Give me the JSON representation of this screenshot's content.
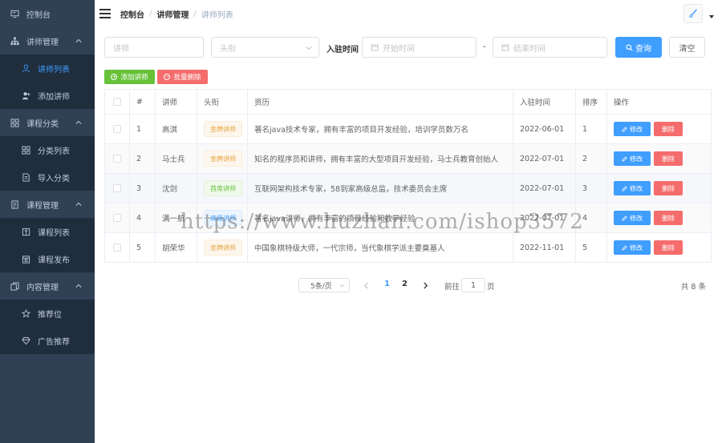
{
  "sidebar": {
    "items": [
      {
        "label": "控制台",
        "type": "top",
        "icon": "monitor-icon"
      },
      {
        "label": "讲师管理",
        "type": "group",
        "icon": "org-chart-icon",
        "expanded": true
      },
      {
        "label": "讲师列表",
        "type": "sub",
        "icon": "user-icon",
        "active": true
      },
      {
        "label": "添加讲师",
        "type": "sub",
        "icon": "user-plus-icon"
      },
      {
        "label": "课程分类",
        "type": "group",
        "icon": "grid-icon",
        "expanded": true
      },
      {
        "label": "分类列表",
        "type": "sub",
        "icon": "grid-icon"
      },
      {
        "label": "导入分类",
        "type": "sub",
        "icon": "document-icon"
      },
      {
        "label": "课程管理",
        "type": "group",
        "icon": "notebook-icon",
        "expanded": true
      },
      {
        "label": "课程列表",
        "type": "sub",
        "icon": "list-box-icon"
      },
      {
        "label": "课程发布",
        "type": "sub",
        "icon": "calendar-icon"
      },
      {
        "label": "内容管理",
        "type": "group",
        "icon": "copy-icon",
        "expanded": true
      },
      {
        "label": "推荐位",
        "type": "sub",
        "icon": "star-icon"
      },
      {
        "label": "广告推荐",
        "type": "sub",
        "icon": "diamond-icon"
      }
    ]
  },
  "header": {
    "breadcrumbs": [
      "控制台",
      "讲师管理",
      "讲师列表"
    ],
    "separator": "/"
  },
  "filter": {
    "name_placeholder": "讲师",
    "title_placeholder": "头衔",
    "join_time_label": "入驻时间",
    "start_placeholder": "开始时间",
    "range_sep": "-",
    "end_placeholder": "结束时间",
    "search_label": "查询",
    "clear_label": "清空"
  },
  "actions": {
    "add_label": "添加讲师",
    "batch_delete_label": "批量删除"
  },
  "table": {
    "columns": [
      "#",
      "讲师",
      "头衔",
      "资历",
      "入驻时间",
      "排序",
      "操作"
    ],
    "edit_label": "修改",
    "delete_label": "删除",
    "rows": [
      {
        "idx": "1",
        "name": "高淇",
        "title": "金牌讲师",
        "tag": "gold",
        "bio": "著名java技术专家，拥有丰富的项目开发经验，培训学员数万名",
        "date": "2022-06-01",
        "sort": "1"
      },
      {
        "idx": "2",
        "name": "马士兵",
        "title": "金牌讲师",
        "tag": "gold",
        "bio": "知名的程序员和讲师，拥有丰富的大型项目开发经验，马士兵教育创始人",
        "date": "2022-07-01",
        "sort": "2"
      },
      {
        "idx": "3",
        "name": "沈剑",
        "title": "首席讲师",
        "tag": "green",
        "bio": "互联网架构技术专家，58到家高级总监，技术委员会主席",
        "date": "2022-07-01",
        "sort": "3"
      },
      {
        "idx": "4",
        "name": "满一航",
        "title": "高级讲师",
        "tag": "blue",
        "bio": "著名java讲师，拥有丰富的项目经验和教学经验",
        "date": "2022-07-01",
        "sort": "4"
      },
      {
        "idx": "5",
        "name": "胡荣华",
        "title": "金牌讲师",
        "tag": "gold",
        "bio": "中国象棋特级大师，一代宗师，当代象棋学派主要奠基人",
        "date": "2022-11-01",
        "sort": "5"
      }
    ]
  },
  "pagination": {
    "page_size_label": "5条/页",
    "pages": [
      "1",
      "2"
    ],
    "current_page": "1",
    "goto_prefix": "前往",
    "goto_value": "1",
    "goto_suffix": "页",
    "total_label": "共 8 条"
  },
  "watermark": "https://www.huzhan.com/ishop3572",
  "colors": {
    "sidebar_bg": "#304156",
    "submenu_bg": "#1f2d3d",
    "primary": "#409eff",
    "success": "#67c23a",
    "danger": "#f56c6c",
    "warning": "#e6a23c"
  }
}
